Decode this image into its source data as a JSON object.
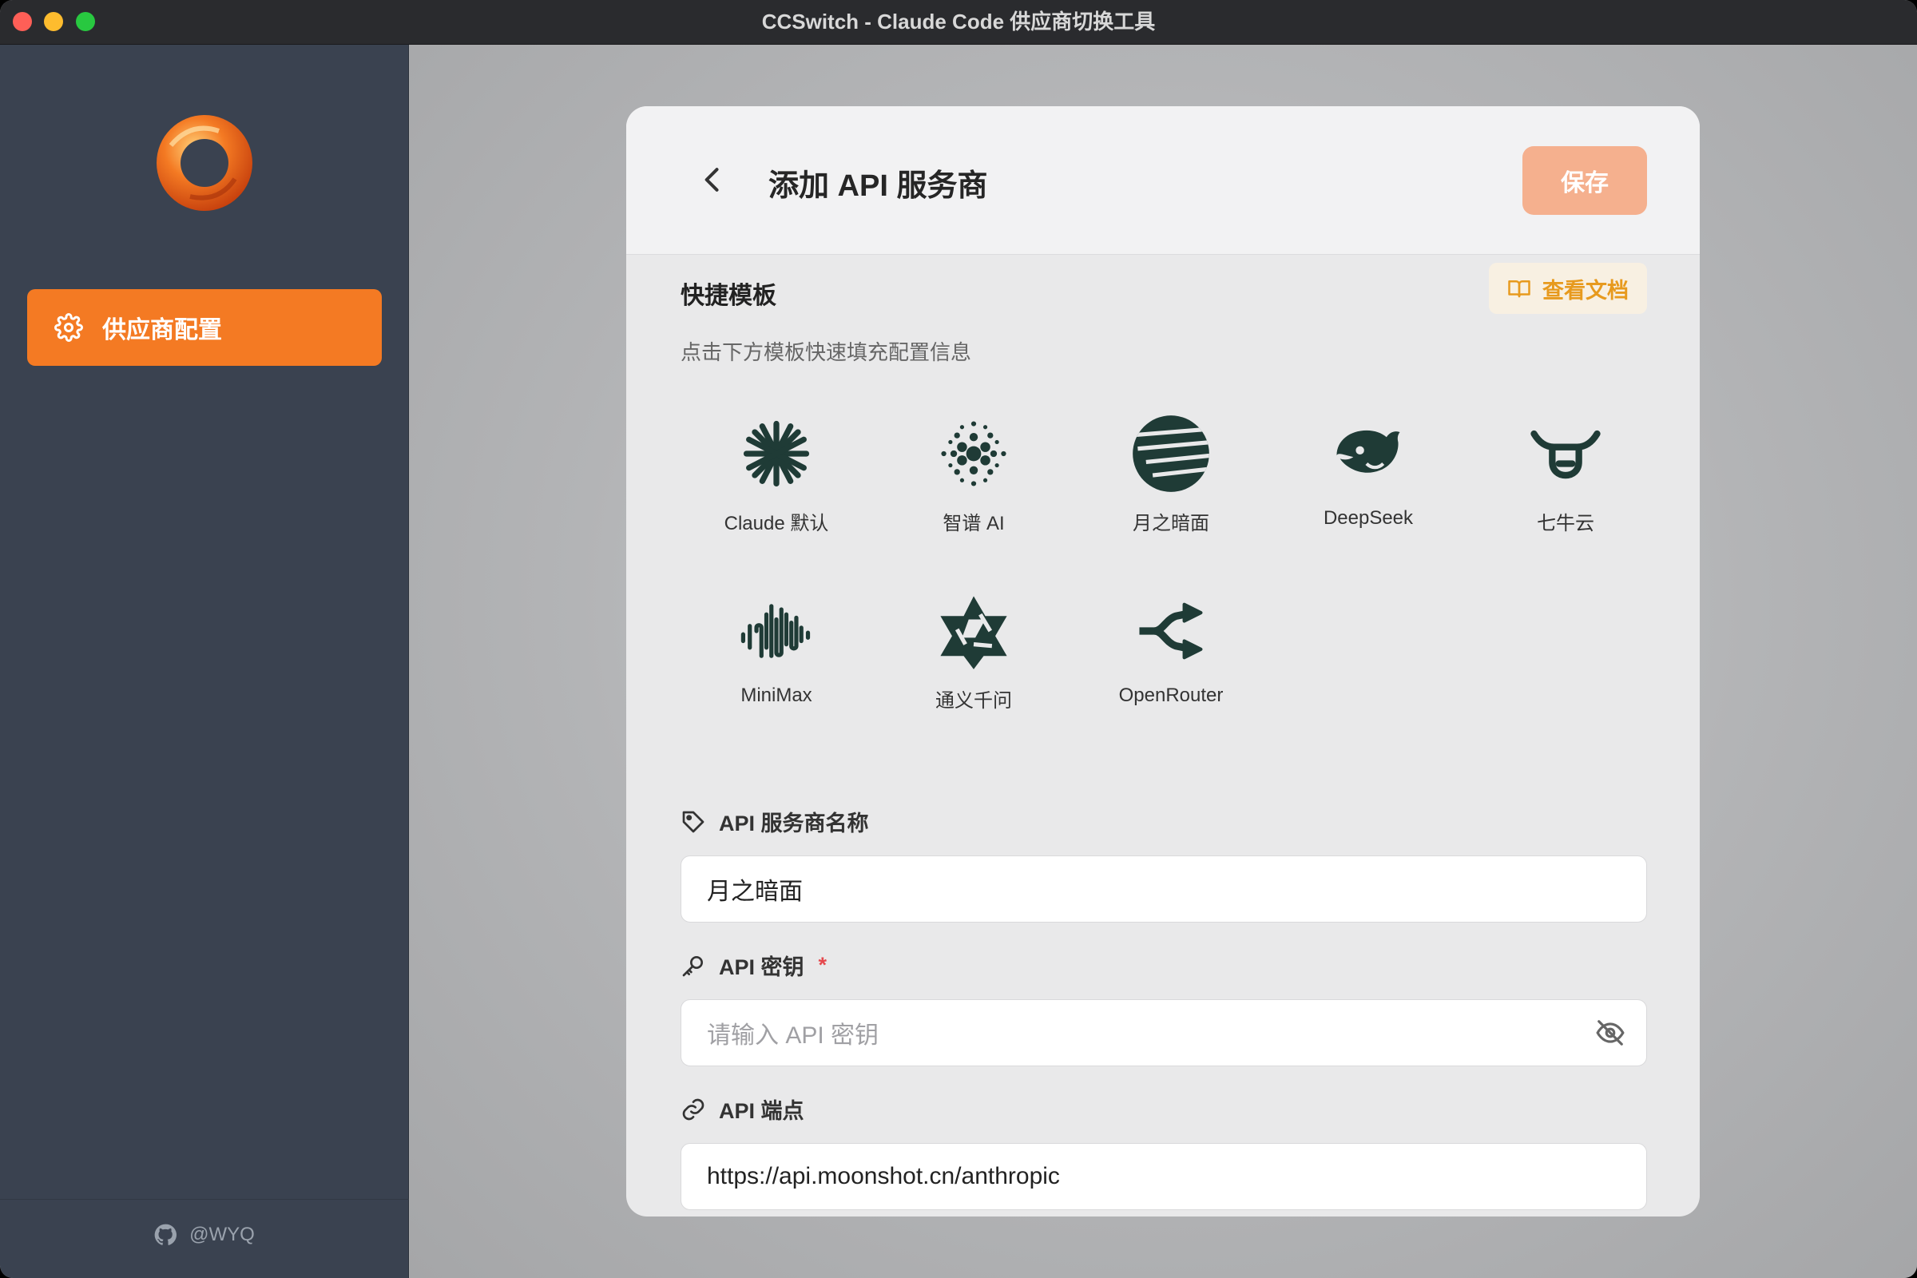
{
  "window": {
    "title": "CCSwitch - Claude Code 供应商切换工具"
  },
  "sidebar": {
    "nav": {
      "label": "供应商配置",
      "icon": "gear-icon"
    },
    "footer": {
      "label": "@WYQ",
      "icon": "github-icon"
    }
  },
  "dialog": {
    "title": "添加 API 服务商",
    "save_label": "保存",
    "templates": {
      "title": "快捷模板",
      "doc_label": "查看文档",
      "description": "点击下方模板快速填充配置信息",
      "items": [
        {
          "label": "Claude 默认",
          "icon": "claude-icon"
        },
        {
          "label": "智谱 AI",
          "icon": "zhipu-icon"
        },
        {
          "label": "月之暗面",
          "icon": "moonshot-icon"
        },
        {
          "label": "DeepSeek",
          "icon": "deepseek-icon"
        },
        {
          "label": "七牛云",
          "icon": "qiniu-icon"
        },
        {
          "label": "MiniMax",
          "icon": "minimax-icon"
        },
        {
          "label": "通义千问",
          "icon": "qwen-icon"
        },
        {
          "label": "OpenRouter",
          "icon": "openrouter-icon"
        }
      ]
    },
    "fields": {
      "name": {
        "label": "API 服务商名称",
        "value": "月之暗面"
      },
      "key": {
        "label": "API 密钥",
        "required_mark": "*",
        "placeholder": "请输入 API 密钥"
      },
      "endpoint": {
        "label": "API 端点",
        "value": "https://api.moonshot.cn/anthropic"
      }
    }
  },
  "colors": {
    "accent": "#f47a23",
    "save_disabled": "#f5b08e",
    "sidebar": "#3a4250",
    "doc_link": "#e79a1e"
  }
}
